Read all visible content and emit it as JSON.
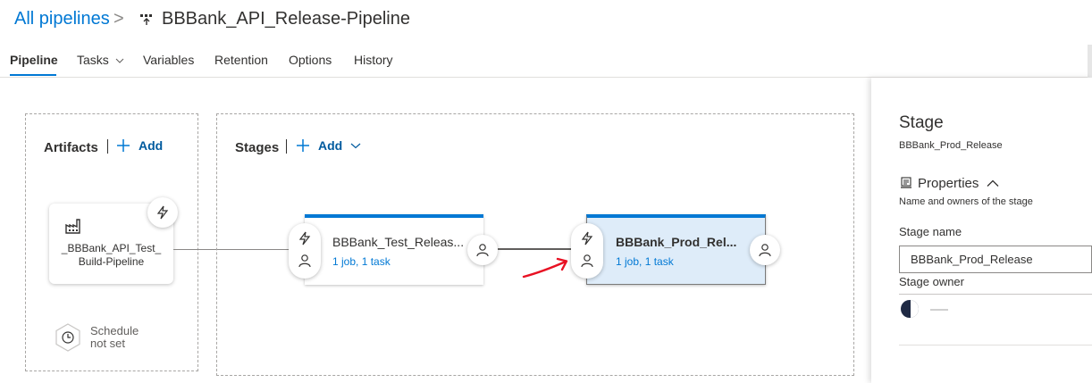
{
  "header": {
    "breadcrumb_root": "All pipelines",
    "breadcrumb_sep": ">",
    "pipeline_title": "BBBank_API_Release-Pipeline"
  },
  "tabs": [
    {
      "label": "Pipeline",
      "active": true
    },
    {
      "label": "Tasks",
      "active": false,
      "has_dropdown": true
    },
    {
      "label": "Variables",
      "active": false
    },
    {
      "label": "Retention",
      "active": false
    },
    {
      "label": "Options",
      "active": false
    },
    {
      "label": "History",
      "active": false
    }
  ],
  "artifacts": {
    "title": "Artifacts",
    "add_label": "Add",
    "artifact_name_line1": "_BBBank_API_Test_",
    "artifact_name_line2": "Build-Pipeline",
    "schedule_line1": "Schedule",
    "schedule_line2": "not set"
  },
  "stages": {
    "title": "Stages",
    "add_label": "Add",
    "items": [
      {
        "name": "BBBank_Test_Releas...",
        "summary": "1 job, 1 task",
        "selected": false
      },
      {
        "name": "BBBank_Prod_Rel...",
        "summary": "1 job, 1 task",
        "selected": true
      }
    ]
  },
  "panel": {
    "title": "Stage",
    "subtitle": "BBBank_Prod_Release",
    "properties_label": "Properties",
    "properties_desc": "Name and owners of the stage",
    "stage_name_label": "Stage name",
    "stage_name_value": "BBBank_Prod_Release",
    "stage_owner_label": "Stage owner"
  },
  "colors": {
    "accent": "#0078d4",
    "selected_stage_bg": "#deecf9",
    "annotation_arrow": "#e81123"
  },
  "icons": [
    "pipeline-icon",
    "chevron-right-icon",
    "chevron-down-icon",
    "plus-icon",
    "lightning-icon",
    "person-icon",
    "build-factory-icon",
    "clock-icon",
    "properties-icon",
    "chevron-up-icon"
  ]
}
